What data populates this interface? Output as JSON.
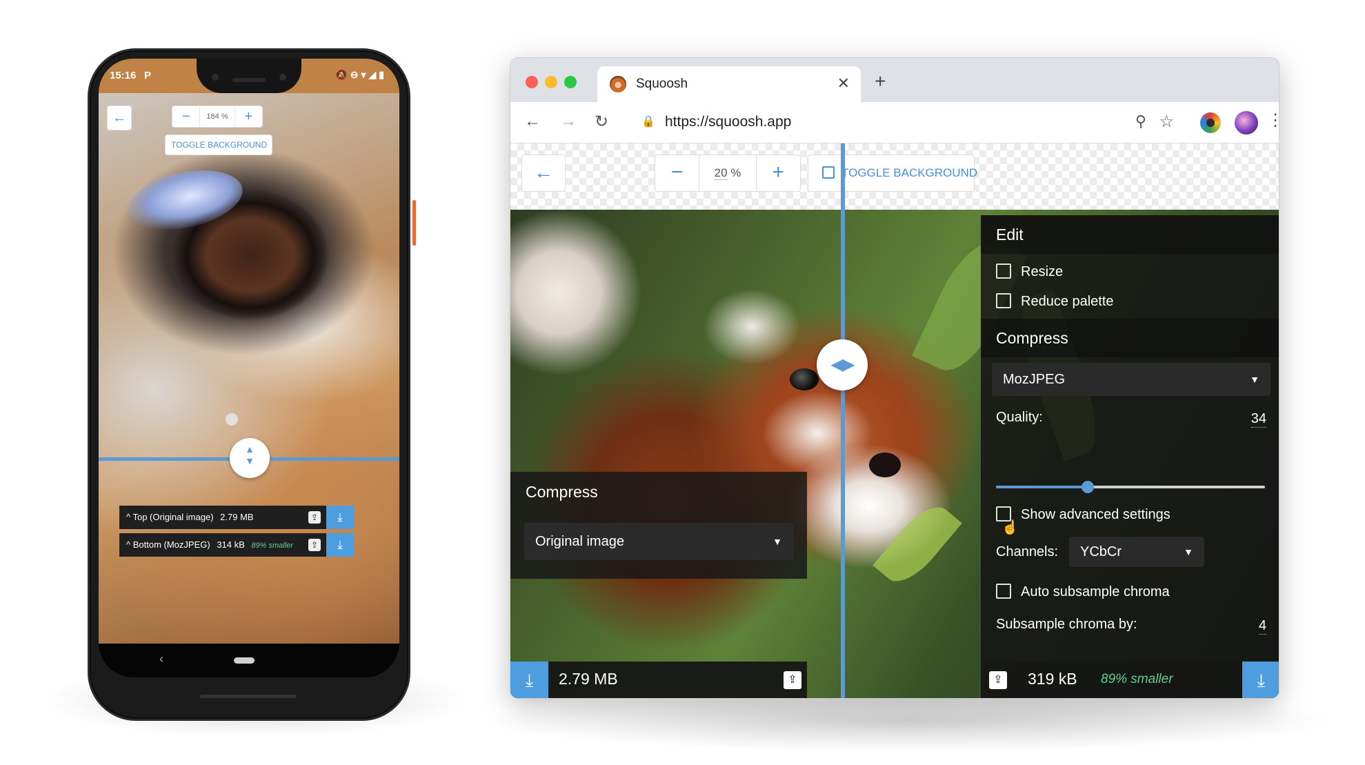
{
  "phone": {
    "status": {
      "time": "15:16",
      "indicator": "P",
      "icons": "🔕⊖▾◢▮"
    },
    "toolbar": {
      "back_icon": "←",
      "zoom_out": "−",
      "zoom_value": "184 %",
      "zoom_in": "+",
      "toggle_background": "TOGGLE BACKGROUND"
    },
    "split_handle_icon": "▲▼",
    "rows": [
      {
        "label": "Top (Original image)",
        "size": "2.79 MB",
        "smaller": ""
      },
      {
        "label": "Bottom (MozJPEG)",
        "size": "314 kB",
        "smaller": "89% smaller"
      }
    ],
    "save_icon": "⇪",
    "download_icon": "⤓",
    "nav_back": "‹"
  },
  "browser": {
    "tab": {
      "title": "Squoosh",
      "close": "✕"
    },
    "new_tab": "+",
    "nav": {
      "back": "←",
      "forward": "→",
      "reload": "↻"
    },
    "omnibox": {
      "lock": "🔒",
      "url": "https://squoosh.app",
      "zoom": "⚲",
      "star": "☆"
    },
    "menu": "⋮"
  },
  "app": {
    "toolbar": {
      "back_icon": "←",
      "zoom_out": "−",
      "zoom_value": "20",
      "zoom_unit": "%",
      "zoom_in": "+",
      "toggle_background": "TOGGLE BACKGROUND"
    },
    "split_handle_icon": "◀▶",
    "left": {
      "panel_title": "Compress",
      "codec": "Original image",
      "size": "2.79 MB"
    },
    "right": {
      "edit_heading": "Edit",
      "resize": {
        "label": "Resize",
        "checked": false
      },
      "reduce_palette": {
        "label": "Reduce palette",
        "checked": false
      },
      "compress_heading": "Compress",
      "codec": "MozJPEG",
      "quality": {
        "label": "Quality:",
        "value": "34",
        "fraction": 0.34
      },
      "advanced": {
        "label": "Show advanced settings",
        "checked": false
      },
      "channels": {
        "label": "Channels:",
        "value": "YCbCr"
      },
      "auto_subsample": {
        "label": "Auto subsample chroma",
        "checked": false
      },
      "subsample": {
        "label": "Subsample chroma by:",
        "value": "4"
      },
      "size": "319 kB",
      "smaller": "89% smaller"
    },
    "caret": "▼",
    "download_icon": "⤓",
    "save_icon": "⇪"
  },
  "colors": {
    "accent": "#4a90d6",
    "split": "#5b9ad4",
    "download": "#4d9ddf",
    "smaller_text": "#5fd08f",
    "panel_bg": "#141414"
  }
}
